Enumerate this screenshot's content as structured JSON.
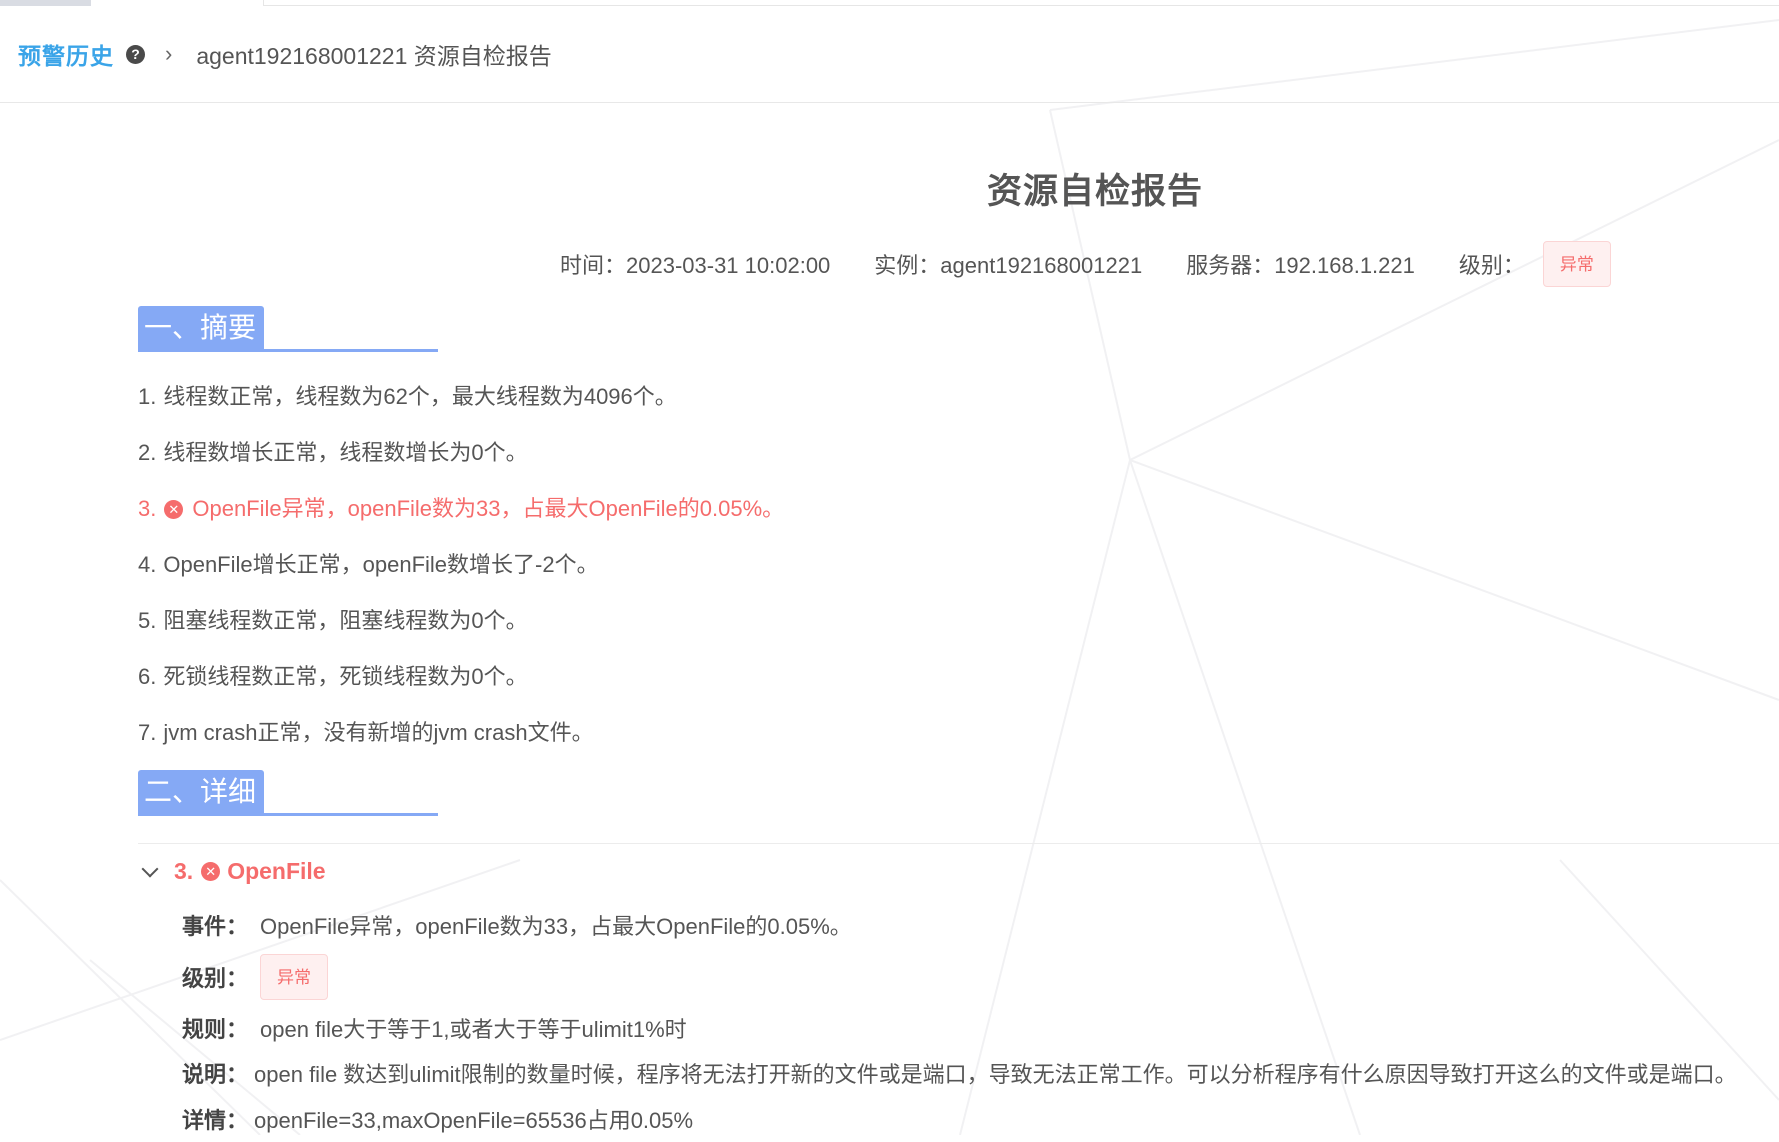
{
  "breadcrumb": {
    "parent": "预警历史",
    "separator": "›",
    "current": "agent192168001221 资源自检报告"
  },
  "report": {
    "title": "资源自检报告",
    "meta": {
      "time": "时间：2023-03-31 10:02:00",
      "instance": "实例：agent192168001221",
      "server": "服务器：192.168.1.221",
      "level_label": "级别：",
      "level_tag": "异常"
    }
  },
  "summary": {
    "heading": "一、摘要",
    "items": [
      {
        "no": "1.",
        "text": "线程数正常，线程数为62个，最大线程数为4096个。",
        "status": "normal"
      },
      {
        "no": "2.",
        "text": "线程数增长正常，线程数增长为0个。",
        "status": "normal"
      },
      {
        "no": "3.",
        "text": "OpenFile异常，openFile数为33，占最大OpenFile的0.05%。",
        "status": "error"
      },
      {
        "no": "4.",
        "text": "OpenFile增长正常，openFile数增长了-2个。",
        "status": "normal"
      },
      {
        "no": "5.",
        "text": "阻塞线程数正常，阻塞线程数为0个。",
        "status": "normal"
      },
      {
        "no": "6.",
        "text": "死锁线程数正常，死锁线程数为0个。",
        "status": "normal"
      },
      {
        "no": "7.",
        "text": "jvm crash正常，没有新增的jvm crash文件。",
        "status": "normal"
      }
    ]
  },
  "detail": {
    "heading": "二、详细",
    "panel": {
      "no": "3.",
      "title": "OpenFile",
      "event_key": "事件：",
      "event_value": "OpenFile异常，openFile数为33，占最大OpenFile的0.05%。",
      "level_key": "级别：",
      "level_tag": "异常",
      "rule_key": "规则：",
      "rule_value": "open file大于等于1,或者大于等于ulimit1%时",
      "desc_key": "说明：",
      "desc_value": "open file 数达到ulimit限制的数量时候，程序将无法打开新的文件或是端口，导致无法正常工作。可以分析程序有什么原因导致打开这么的文件或是端口。",
      "info_key": "详情：",
      "info_value": "openFile=33,maxOpenFile=65536占用0.05%"
    }
  },
  "icons": {
    "help": "question-circle-icon",
    "error": "close-circle-icon",
    "collapse": "chevron-down-icon"
  },
  "colors": {
    "accent": "#85a9f5",
    "link": "#3aa4e8",
    "danger": "#f56c6c",
    "danger_bg": "#fef0f0"
  }
}
